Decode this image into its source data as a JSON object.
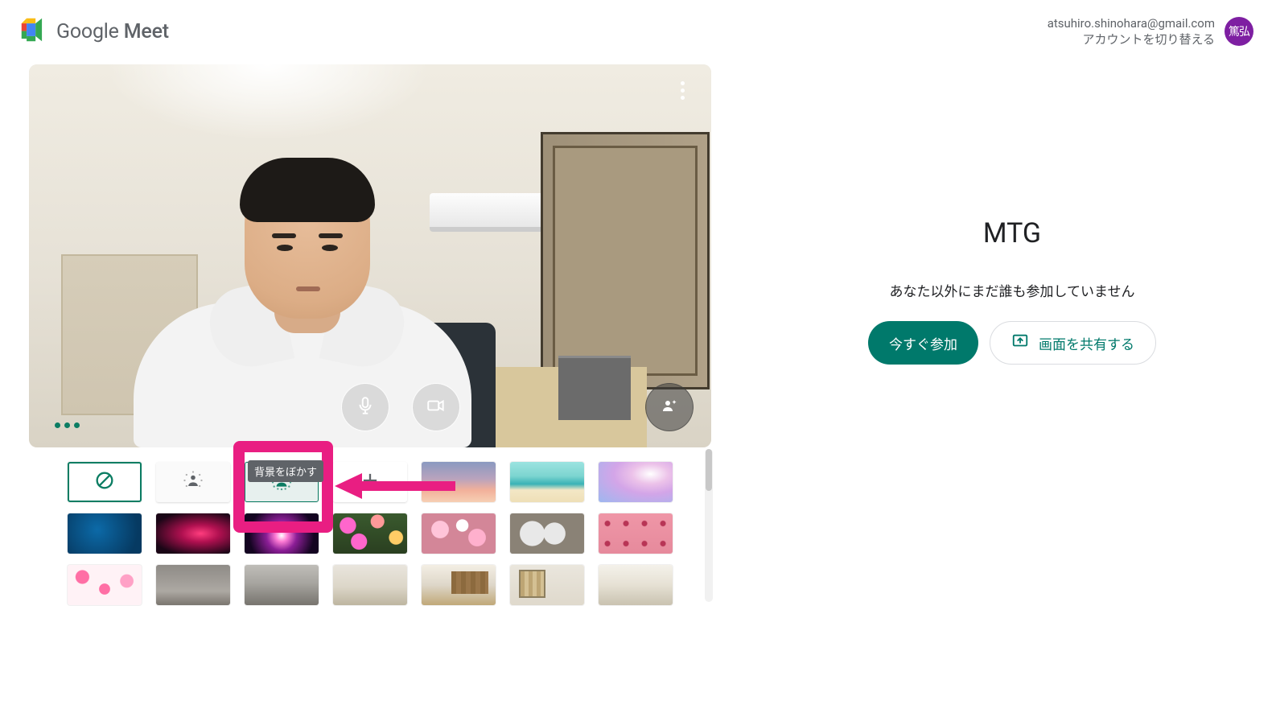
{
  "brand": {
    "name_a": "Google",
    "name_b": "Meet"
  },
  "account": {
    "email": "atsuhiro.shinohara@gmail.com",
    "switch_label": "アカウントを切り替える",
    "avatar_text": "篤弘"
  },
  "meeting": {
    "title": "MTG",
    "subtitle": "あなた以外にまだ誰も参加していません",
    "join_label": "今すぐ参加",
    "present_label": "画面を共有する"
  },
  "tooltip": {
    "blur_bg": "背景をぼかす"
  },
  "preview": {
    "mic_tooltip": "マイク",
    "cam_tooltip": "カメラ",
    "effects_tooltip": "ビジュアル エフェクト",
    "more_tooltip": "その他"
  }
}
